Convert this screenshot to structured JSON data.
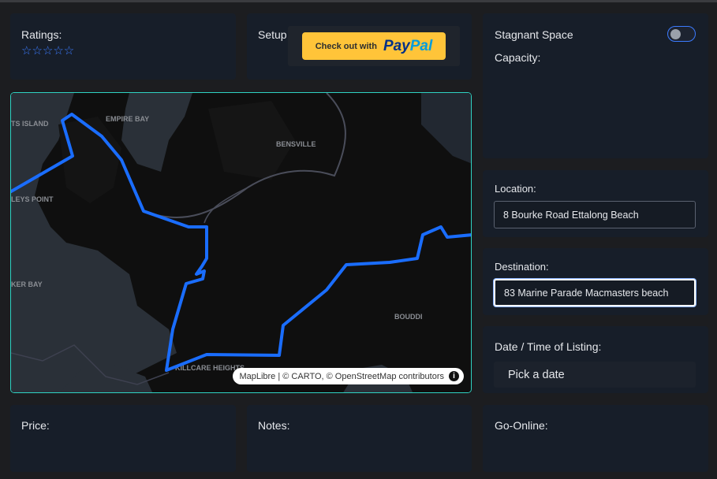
{
  "ratings": {
    "label": "Ratings:",
    "stars": "☆☆☆☆☆",
    "value": 0,
    "max": 5
  },
  "setup": {
    "label": "Setup"
  },
  "paypal": {
    "prefix": "Check out with",
    "brand_part1": "Pay",
    "brand_part2": "Pal"
  },
  "stagnant": {
    "label": "Stagnant Space",
    "toggle_on": false,
    "capacity_label": "Capacity:"
  },
  "location": {
    "label": "Location:",
    "value": "8 Bourke Road Ettalong Beach"
  },
  "destination": {
    "label": "Destination:",
    "value": "83 Marine Parade Macmasters beach"
  },
  "listing": {
    "label": "Date / Time of Listing:",
    "picker_text": "Pick a date"
  },
  "price": {
    "label": "Price:"
  },
  "notes": {
    "label": "Notes:"
  },
  "go_online": {
    "label": "Go-Online:"
  },
  "map": {
    "attribution": "MapLibre | © CARTO, © OpenStreetMap contributors",
    "places": [
      "EMPIRE BAY",
      "BENSVILLE",
      "BOUDDI",
      "KILLCARE HEIGHTS",
      "TS ISLAND",
      "LEYS POINT",
      "KER BAY"
    ],
    "route_color": "#1a6dff",
    "border_color": "#2fd3c3"
  },
  "colors": {
    "background": "#1c1d20",
    "card": "#171e29",
    "accent": "#3b7bff",
    "paypal_yellow": "#ffc439"
  }
}
